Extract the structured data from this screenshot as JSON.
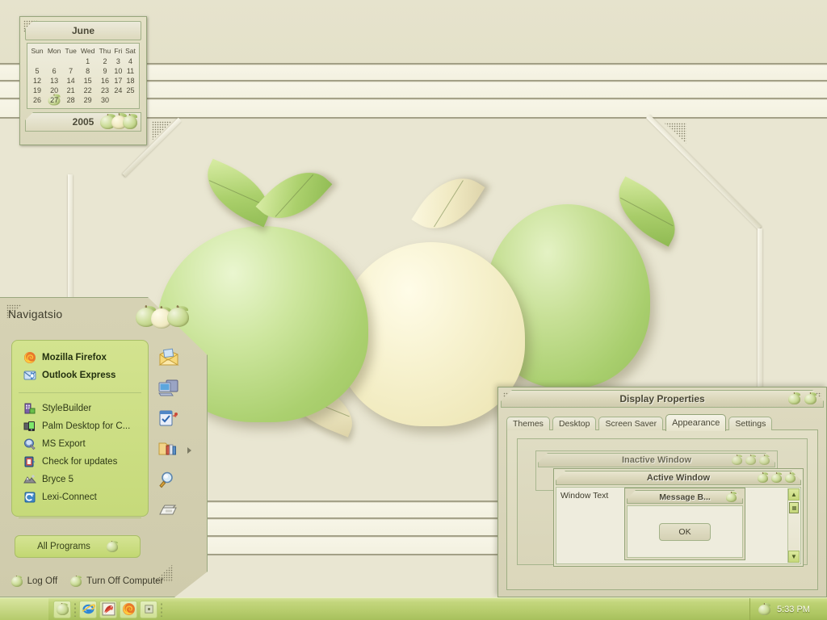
{
  "theme": {
    "name": "Apple green XP style",
    "accent": "#a8c066",
    "desktop_bg": "#e9e6d2",
    "taskbar_green": "#b6cc6c",
    "window_beige": "#dedac0"
  },
  "calendar": {
    "month": "June",
    "year": "2005",
    "weekday_headers": [
      "Sun",
      "Mon",
      "Tue",
      "Wed",
      "Thu",
      "Fri",
      "Sat"
    ],
    "weeks": [
      [
        "",
        "",
        "",
        "1",
        "2",
        "3",
        "4"
      ],
      [
        "5",
        "6",
        "7",
        "8",
        "9",
        "10",
        "11"
      ],
      [
        "12",
        "13",
        "14",
        "15",
        "16",
        "17",
        "18"
      ],
      [
        "19",
        "20",
        "21",
        "22",
        "23",
        "24",
        "25"
      ],
      [
        "26",
        "27",
        "28",
        "29",
        "30",
        "",
        ""
      ]
    ],
    "today": "27"
  },
  "start_menu": {
    "user_name": "Navigatsio",
    "pinned": [
      {
        "label": "Mozilla Firefox",
        "icon": "firefox-icon"
      },
      {
        "label": "Outlook Express",
        "icon": "outlook-express-icon"
      }
    ],
    "recent": [
      {
        "label": "StyleBuilder",
        "icon": "stylebuilder-icon"
      },
      {
        "label": "Palm Desktop for C...",
        "icon": "palm-desktop-icon"
      },
      {
        "label": "MS Export",
        "icon": "ms-export-icon"
      },
      {
        "label": "Check for updates",
        "icon": "check-for-updates-icon"
      },
      {
        "label": "Bryce 5",
        "icon": "bryce-icon"
      },
      {
        "label": "Lexi-Connect",
        "icon": "lexi-connect-icon"
      }
    ],
    "right_icons": [
      {
        "name": "mail-icon"
      },
      {
        "name": "my-computer-icon"
      },
      {
        "name": "control-panel-icon"
      },
      {
        "name": "help-and-support-icon"
      },
      {
        "name": "search-icon"
      },
      {
        "name": "run-icon"
      }
    ],
    "all_programs_label": "All Programs",
    "log_off_label": "Log Off",
    "turn_off_label": "Turn Off Computer"
  },
  "display_properties": {
    "title": "Display Properties",
    "titlebar_buttons": [
      "minimize-apple-button",
      "close-apple-button"
    ],
    "tabs": [
      {
        "label": "Themes",
        "active": false
      },
      {
        "label": "Desktop",
        "active": false
      },
      {
        "label": "Screen Saver",
        "active": false
      },
      {
        "label": "Appearance",
        "active": true
      },
      {
        "label": "Settings",
        "active": false
      }
    ],
    "preview": {
      "inactive_window_title": "Inactive Window",
      "active_window_title": "Active Window",
      "window_text": "Window Text",
      "message_box_title": "Message B...",
      "ok_button": "OK"
    }
  },
  "taskbar": {
    "quick_launch": [
      {
        "name": "show-desktop-apple-icon"
      },
      {
        "name": "internet-explorer-icon"
      },
      {
        "name": "dragon-app-icon"
      },
      {
        "name": "firefox-icon"
      },
      {
        "name": "media-player-icon"
      }
    ],
    "tray": {
      "icon": "apple-tray-icon",
      "clock": "5:33 PM"
    }
  },
  "wallpaper": {
    "description": "Three glossy apples with leaves on beige paneled background",
    "apple_green": "#b6d67f",
    "apple_cream": "#f5f1cf"
  }
}
